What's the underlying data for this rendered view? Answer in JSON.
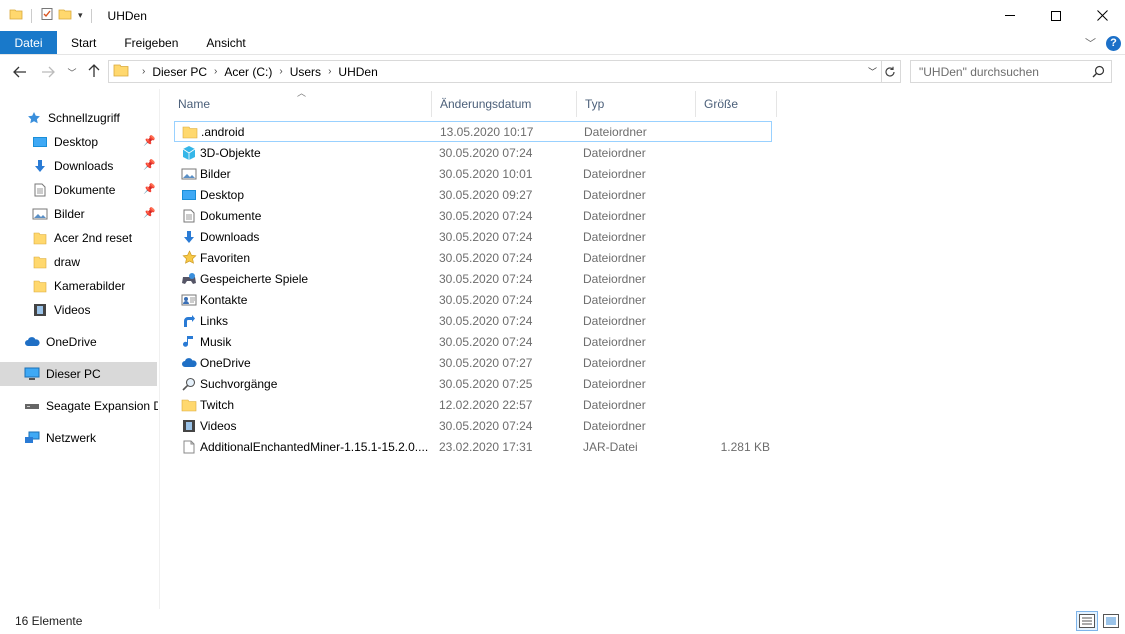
{
  "window": {
    "title": "UHDen",
    "controls": {
      "minimize": "—",
      "maximize": "☐",
      "close": "✕"
    }
  },
  "ribbon": {
    "tabs": [
      "Datei",
      "Start",
      "Freigeben",
      "Ansicht"
    ],
    "help": "?"
  },
  "address": {
    "crumbs": [
      "Dieser PC",
      "Acer (C:)",
      "Users",
      "UHDen"
    ]
  },
  "search": {
    "placeholder": "\"UHDen\" durchsuchen"
  },
  "nav": {
    "quick_access": "Schnellzugriff",
    "items": [
      {
        "label": "Desktop",
        "icon": "desktop-icon",
        "pinned": true
      },
      {
        "label": "Downloads",
        "icon": "downloads-icon",
        "pinned": true
      },
      {
        "label": "Dokumente",
        "icon": "documents-icon",
        "pinned": true
      },
      {
        "label": "Bilder",
        "icon": "pictures-icon",
        "pinned": true
      },
      {
        "label": "Acer 2nd reset",
        "icon": "folder-icon",
        "pinned": false
      },
      {
        "label": "draw",
        "icon": "folder-icon",
        "pinned": false
      },
      {
        "label": "Kamerabilder",
        "icon": "folder-icon",
        "pinned": false
      },
      {
        "label": "Videos",
        "icon": "videos-icon",
        "pinned": false
      }
    ],
    "onedrive": "OneDrive",
    "this_pc": "Dieser PC",
    "seagate": "Seagate Expansion Dr",
    "network": "Netzwerk"
  },
  "columns": {
    "name": "Name",
    "date": "Änderungsdatum",
    "type": "Typ",
    "size": "Größe"
  },
  "files": [
    {
      "name": ".android",
      "date": "13.05.2020 10:17",
      "type": "Dateiordner",
      "size": "",
      "icon": "folder-icon"
    },
    {
      "name": "3D-Objekte",
      "date": "30.05.2020 07:24",
      "type": "Dateiordner",
      "size": "",
      "icon": "3d-objects-icon"
    },
    {
      "name": "Bilder",
      "date": "30.05.2020 10:01",
      "type": "Dateiordner",
      "size": "",
      "icon": "pictures-icon"
    },
    {
      "name": "Desktop",
      "date": "30.05.2020 09:27",
      "type": "Dateiordner",
      "size": "",
      "icon": "desktop-icon"
    },
    {
      "name": "Dokumente",
      "date": "30.05.2020 07:24",
      "type": "Dateiordner",
      "size": "",
      "icon": "documents-icon"
    },
    {
      "name": "Downloads",
      "date": "30.05.2020 07:24",
      "type": "Dateiordner",
      "size": "",
      "icon": "downloads-icon"
    },
    {
      "name": "Favoriten",
      "date": "30.05.2020 07:24",
      "type": "Dateiordner",
      "size": "",
      "icon": "favorites-icon"
    },
    {
      "name": "Gespeicherte Spiele",
      "date": "30.05.2020 07:24",
      "type": "Dateiordner",
      "size": "",
      "icon": "saved-games-icon"
    },
    {
      "name": "Kontakte",
      "date": "30.05.2020 07:24",
      "type": "Dateiordner",
      "size": "",
      "icon": "contacts-icon"
    },
    {
      "name": "Links",
      "date": "30.05.2020 07:24",
      "type": "Dateiordner",
      "size": "",
      "icon": "links-icon"
    },
    {
      "name": "Musik",
      "date": "30.05.2020 07:24",
      "type": "Dateiordner",
      "size": "",
      "icon": "music-icon"
    },
    {
      "name": "OneDrive",
      "date": "30.05.2020 07:27",
      "type": "Dateiordner",
      "size": "",
      "icon": "onedrive-icon"
    },
    {
      "name": "Suchvorgänge",
      "date": "30.05.2020 07:25",
      "type": "Dateiordner",
      "size": "",
      "icon": "searches-icon"
    },
    {
      "name": "Twitch",
      "date": "12.02.2020 22:57",
      "type": "Dateiordner",
      "size": "",
      "icon": "folder-icon"
    },
    {
      "name": "Videos",
      "date": "30.05.2020 07:24",
      "type": "Dateiordner",
      "size": "",
      "icon": "videos-icon"
    },
    {
      "name": "AdditionalEnchantedMiner-1.15.1-15.2.0....",
      "date": "23.02.2020 17:31",
      "type": "JAR-Datei",
      "size": "1.281 KB",
      "icon": "file-icon"
    }
  ],
  "status": {
    "count": "16 Elemente"
  },
  "colors": {
    "accent": "#1979ca",
    "folder": "#ffd86e",
    "selection_border": "#99d1ff"
  }
}
